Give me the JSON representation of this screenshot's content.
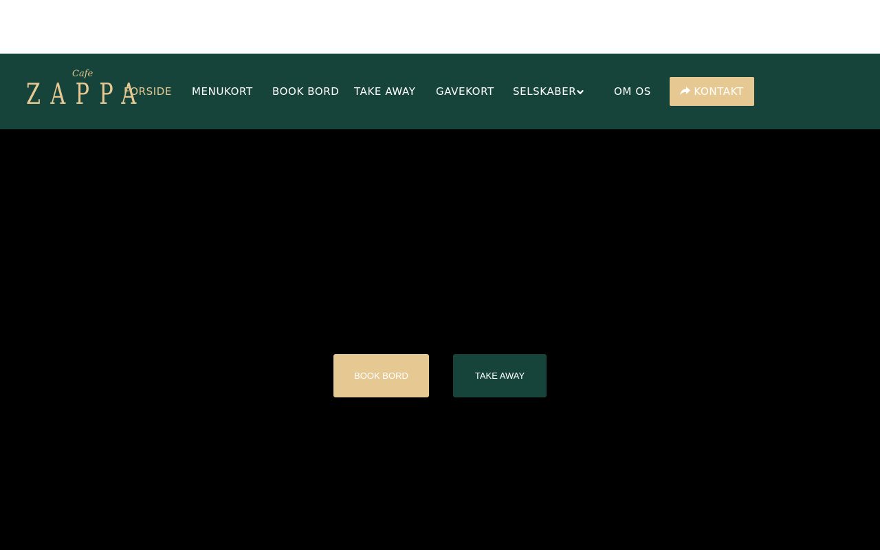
{
  "brand": {
    "script": "Cafe",
    "name": "ZAPPA"
  },
  "nav": {
    "items": [
      {
        "label": "FORSIDE",
        "active": true
      },
      {
        "label": "MENUKORT"
      },
      {
        "label": "BOOK BORD"
      },
      {
        "label": "TAKE AWAY"
      },
      {
        "label": "GAVEKORT"
      },
      {
        "label": "SELSKABER",
        "has_dropdown": true
      },
      {
        "label": "OM OS"
      }
    ],
    "contact_label": "KONTAKT"
  },
  "hero": {
    "book_label": "BOOK BORD",
    "takeaway_label": "TAKE AWAY"
  },
  "colors": {
    "navbar": "#17443a",
    "accent": "#e6c992",
    "hero_bg": "#000000",
    "top_bar": "#ffffff"
  },
  "icons": {
    "dropdown": "chevron-down-icon",
    "contact": "share-arrow-icon"
  }
}
